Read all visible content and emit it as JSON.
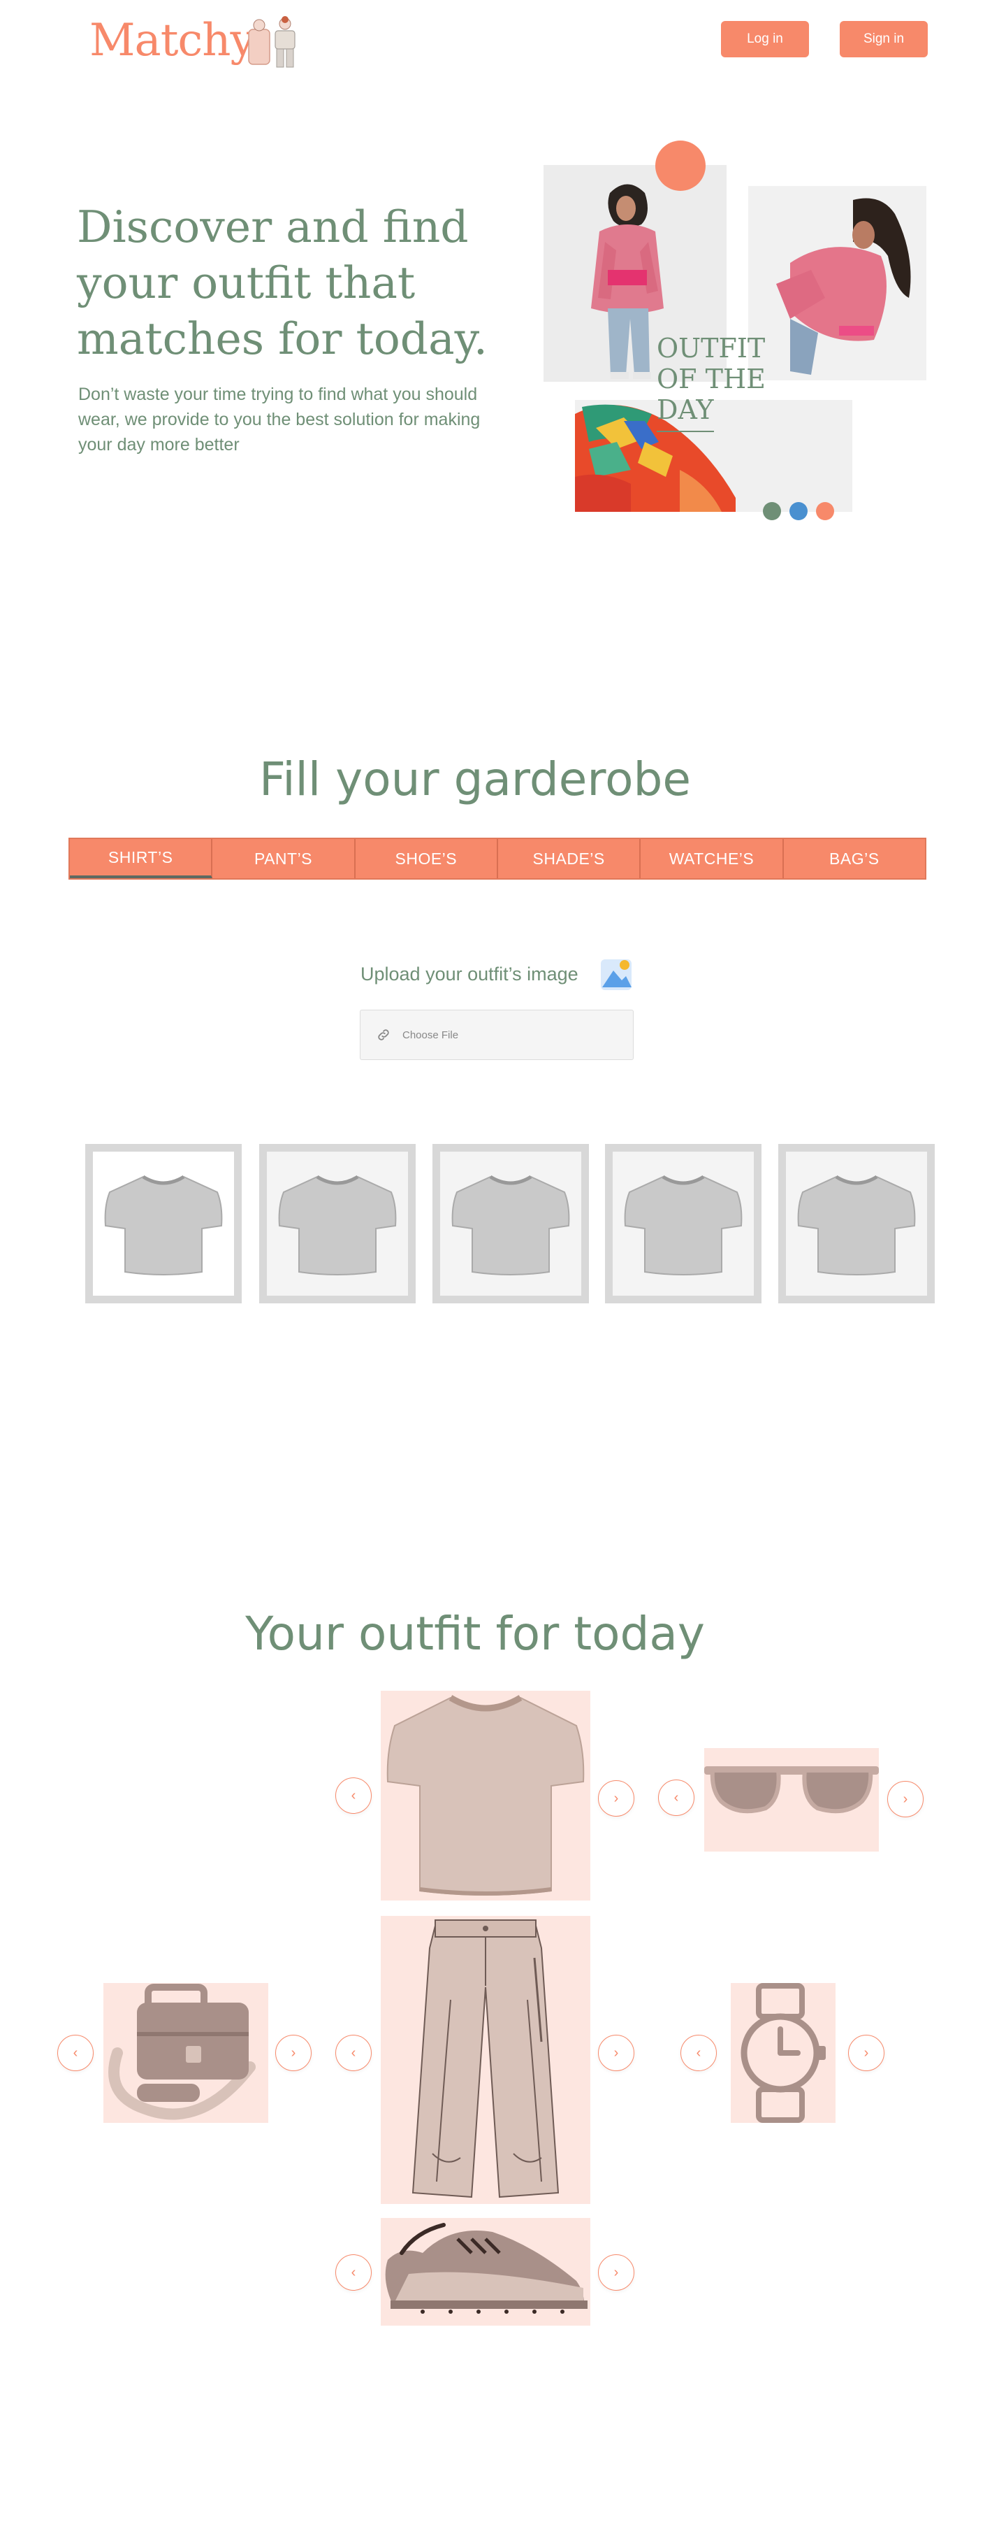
{
  "header": {
    "logo_text": "Matchy",
    "login_label": "Log in",
    "signin_label": "Sign in"
  },
  "hero": {
    "title": "Discover and find your outfit that matches for today.",
    "subtitle": "Don’t waste your time trying to find what you should wear, we provide to you the best solution for making your day more better",
    "badge_text": "OUTFIT OF THE DAY",
    "dot_colors": [
      "#6f8f76",
      "#4a90d0",
      "#f7896a"
    ]
  },
  "wardrobe": {
    "title": "Fill your garderobe",
    "tabs": [
      "SHIRT’S",
      "PANT’S",
      "SHOE’S",
      "SHADE’S",
      "WATCHE’S",
      "BAG’S"
    ],
    "active_tab": 0,
    "upload_label": "Upload your outfit’s image",
    "file_input_label": "Choose File",
    "items_count_icons": [
      "tshirt-icon",
      "tshirt-icon",
      "tshirt-icon",
      "tshirt-icon",
      "tshirt-icon"
    ]
  },
  "outfit": {
    "title": "Your outfit for today",
    "prev_symbol": "‹",
    "next_symbol": "›",
    "slots": [
      "shirt",
      "sunglasses",
      "bag",
      "pants",
      "watch",
      "shoes"
    ]
  },
  "colors": {
    "accent": "#f7896a",
    "primary_text": "#6f8f76",
    "tile_bg": "#fde6e0",
    "item_fill": "#d8c2b9"
  }
}
